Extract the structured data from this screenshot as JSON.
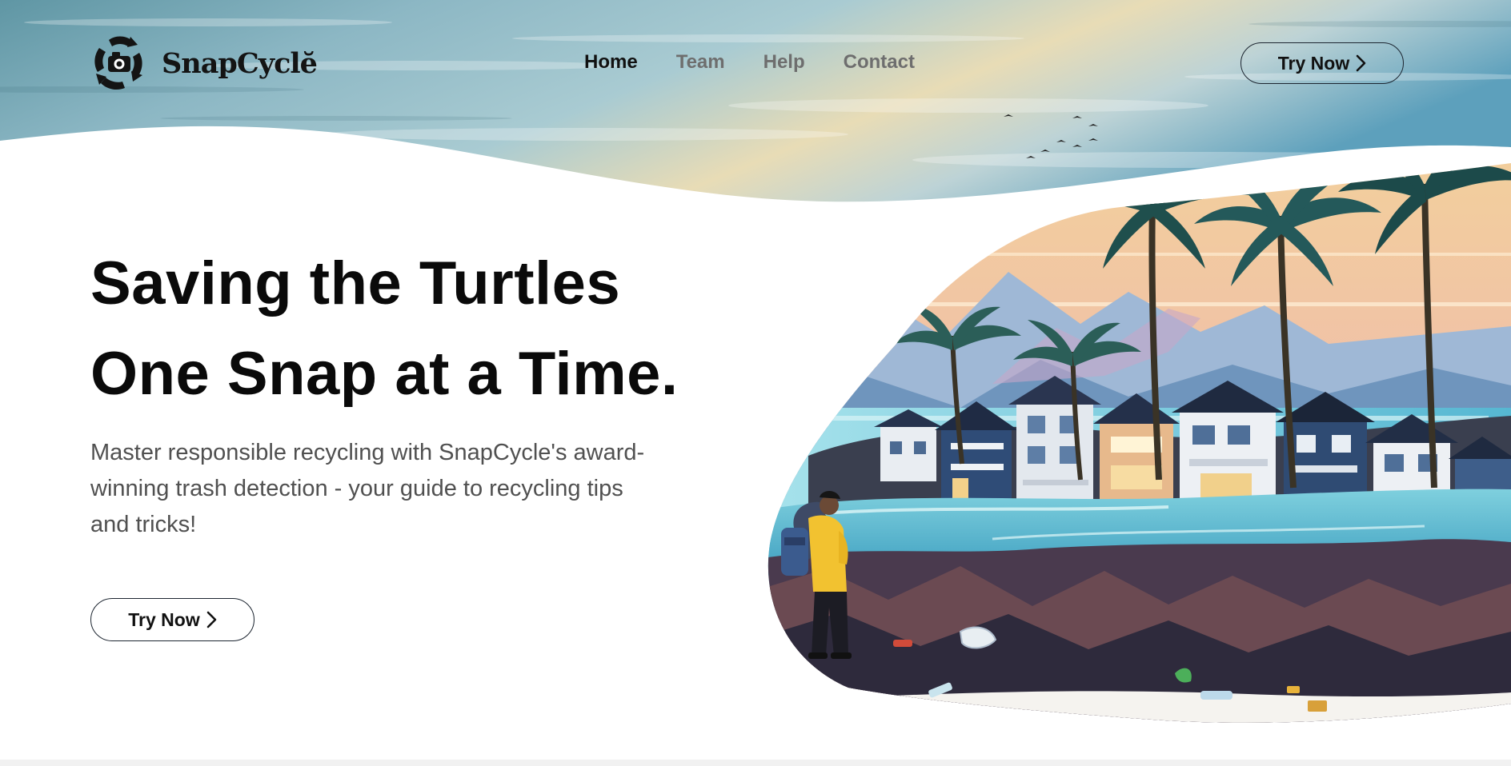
{
  "brand": {
    "name": "SnapCyclĕ",
    "logo_icon": "recycle-camera-icon"
  },
  "nav": {
    "items": [
      {
        "label": "Home",
        "active": true
      },
      {
        "label": "Team",
        "active": false
      },
      {
        "label": "Help",
        "active": false
      },
      {
        "label": "Contact",
        "active": false
      }
    ]
  },
  "header": {
    "cta_label": "Try Now",
    "cta_icon": "chevron-right-icon"
  },
  "hero": {
    "title_line1": "Saving the Turtles",
    "title_line2": "One Snap at a Time.",
    "subtitle": "Master responsible recycling with SnapCycle's award-winning trash detection - your guide to recycling tips and tricks!",
    "cta_label": "Try Now",
    "cta_icon": "chevron-right-icon"
  },
  "colors": {
    "text_primary": "#0a0a0a",
    "nav_inactive": "#6e6e6e",
    "subtitle": "#505050",
    "button_border": "#1c2530",
    "jacket_yellow": "#f2c230",
    "sea_teal": "#6ecbdc"
  }
}
